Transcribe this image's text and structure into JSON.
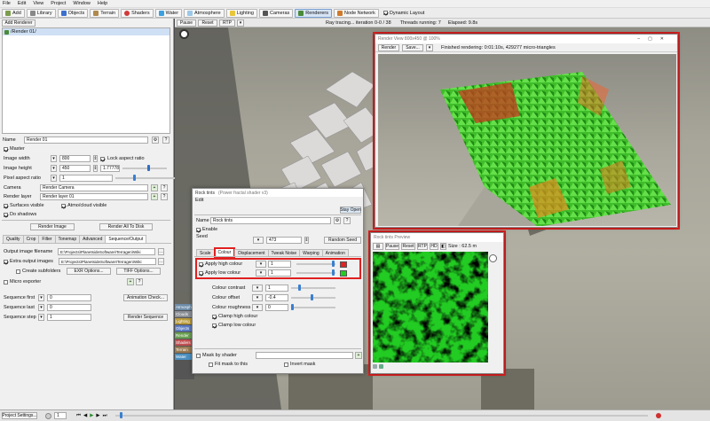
{
  "menu": [
    "File",
    "Edit",
    "View",
    "Project",
    "Window",
    "Help"
  ],
  "toolbar": {
    "items": [
      "Add",
      "Library",
      "Objects",
      "Terrain",
      "Shaders",
      "Water",
      "Atmosphere",
      "Lighting",
      "Cameras",
      "Renderers",
      "Node Network"
    ],
    "dynamic_layout": "Dynamic Layout"
  },
  "left": {
    "add_renderer": "Add Renderer",
    "tree_item": "/Render 01/",
    "name_label": "Name",
    "name_value": "Render 01",
    "master": "Master",
    "image_width_label": "Image width",
    "image_width": "800",
    "image_height_label": "Image height",
    "image_height": "450",
    "lock_aspect": "Lock aspect ratio",
    "aspect_value": "1.77778",
    "pixel_aspect_label": "Pixel aspect ratio",
    "pixel_aspect": "1",
    "camera_label": "Camera",
    "camera_value": "Render Camera",
    "render_layer_label": "Render layer",
    "render_layer_value": "Render layer 01",
    "surfaces_visible": "Surfaces visible",
    "atmo_visible": "Atmo/cloud visible",
    "do_shadows": "Do shadows",
    "render_image": "Render Image",
    "render_all": "Render All To Disk",
    "tabs": [
      "Quality",
      "Crop",
      "Filter",
      "Tonemap",
      "Advanced",
      "Sequence/Output"
    ],
    "output_label": "Output image filename",
    "output_value": "E:\\Projects\\PlanetsideSoftware\\Terragen\\Wiki",
    "extra_label": "Extra output images",
    "extra_value": "E:\\Projects\\PlanetsideSoftware\\Terragen\\Wiki",
    "create_subfolders": "Create subfolders",
    "exr_options": "EXR Options...",
    "tiff_options": "TIFF Options...",
    "micro_exporter": "Micro exporter",
    "seq_first_label": "Sequence first",
    "seq_first": "0",
    "seq_last_label": "Sequence last",
    "seq_last": "0",
    "seq_step_label": "Sequence step",
    "seq_step": "1",
    "animation_check": "Animation Check...",
    "render_sequence": "Render Sequence"
  },
  "viewport": {
    "buttons": [
      "Pause",
      "Reset",
      "RTP"
    ],
    "status": "Ray tracing... iteration 0-0 / 38",
    "threads": "Threads running: 7",
    "elapsed": "Elapsed: 9.8s"
  },
  "render_view": {
    "title": "Render View 800x450 @ 100%",
    "render_btn": "Render",
    "save_btn": "Save...",
    "status": "Finished rendering: 0:01:10s, 429277 micro-triangles"
  },
  "rock_dialog": {
    "title": "Rock tints",
    "subtitle": "(Power fractal shader v3)",
    "edit": "Edit",
    "stay_open": "Stay Open",
    "name_label": "Name",
    "name_value": "Rock tints",
    "enable": "Enable",
    "seed_label": "Seed",
    "seed_value": "473",
    "random_seed": "Random Seed",
    "tabs": [
      "Scale",
      "Colour",
      "Displacement",
      "Tweak Noise",
      "Warping",
      "Animation"
    ],
    "apply_high": "Apply high colour",
    "apply_high_val": "1",
    "apply_low": "Apply low colour",
    "apply_low_val": "1",
    "contrast_label": "Colour contrast",
    "contrast_val": "1",
    "offset_label": "Colour offset",
    "offset_val": "-0.4",
    "roughness_label": "Colour roughness",
    "roughness_val": "0",
    "clamp_high": "Clamp high colour",
    "clamp_low": "Clamp low colour",
    "mask_label": "Mask by shader",
    "fit_mask": "Fit mask to this",
    "invert_mask": "Invert mask",
    "high_color": "#e02424",
    "low_color": "#22cc22"
  },
  "preview": {
    "title": "Rock tints Preview",
    "buttons": [
      "Pause",
      "Reset",
      "RTP",
      "HD"
    ],
    "size": "Size : 62.5 m"
  },
  "behind_items": [
    "Atmosphere",
    "Clouds",
    "Lighting",
    "Objects",
    "Render",
    "Shaders",
    "Terrain",
    "Water"
  ],
  "statusbar": {
    "project_settings": "Project Settings...",
    "frame": "1"
  }
}
